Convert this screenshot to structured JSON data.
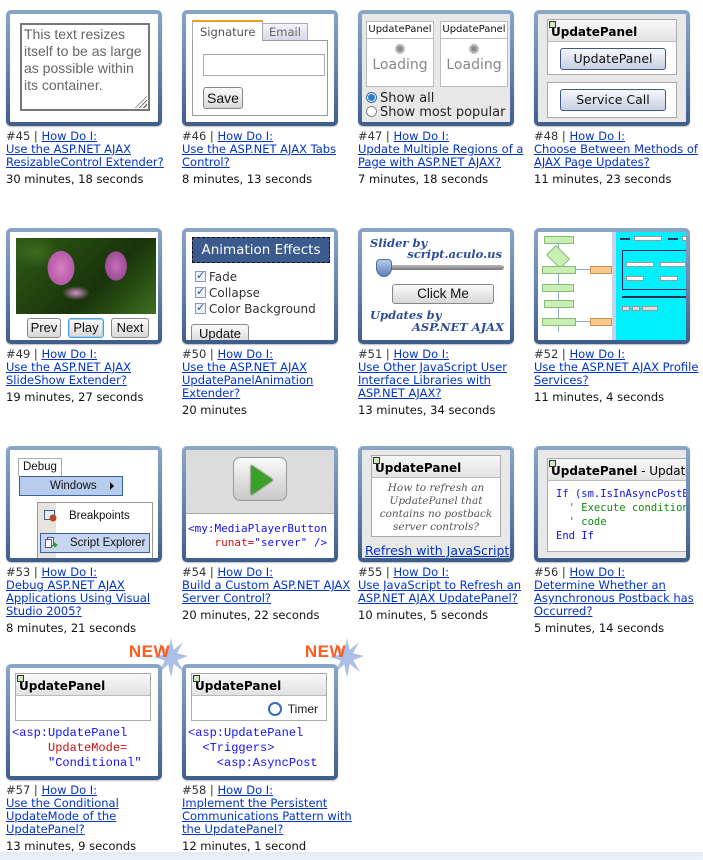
{
  "link_prefix": "How Do I:",
  "new_badge_label": "NEW",
  "colors": {
    "frame": "#4a6a9a",
    "link": "#0033cc",
    "new_badge": "#ff5a1a"
  },
  "videos": [
    {
      "number": "#45 |",
      "title": "Use the ASP.NET AJAX ResizableControl Extender?",
      "duration": "30 minutes, 18 seconds",
      "thumbnail": {
        "text": "This text resizes itself to be as large as possible within its container."
      }
    },
    {
      "number": "#46 |",
      "title": "Use the ASP.NET AJAX Tabs Control?",
      "duration": "8 minutes, 13 seconds",
      "thumbnail": {
        "tabs": [
          "Signature",
          "Email"
        ],
        "active_tab": "Signature",
        "input_value": "",
        "button": "Save"
      }
    },
    {
      "number": "#47 |",
      "title": "Update Multiple Regions of a Page with ASP.NET AJAX?",
      "duration": "7 minutes, 18 seconds",
      "thumbnail": {
        "panels": [
          {
            "header": "UpdatePanel",
            "status": "Loading"
          },
          {
            "header": "UpdatePanel",
            "status": "Loading"
          }
        ],
        "radio_options": [
          {
            "label": "Show all",
            "selected": true
          },
          {
            "label": "Show most popular",
            "selected": false
          }
        ]
      }
    },
    {
      "number": "#48 |",
      "title": "Choose Between Methods of AJAX Page Updates?",
      "duration": "11 minutes, 23 seconds",
      "thumbnail": {
        "header": "UpdatePanel",
        "buttons": [
          "UpdatePanel",
          "Service Call"
        ]
      }
    },
    {
      "number": "#49 |",
      "title": "Use the ASP.NET AJAX SlideShow Extender?",
      "duration": "19 minutes, 27 seconds",
      "thumbnail": {
        "buttons": [
          "Prev",
          "Play",
          "Next"
        ]
      }
    },
    {
      "number": "#50 |",
      "title": "Use the ASP.NET AJAX UpdatePanelAnimation Extender?",
      "duration": "20 minutes",
      "thumbnail": {
        "header": "Animation Effects",
        "checkboxes": [
          {
            "label": "Fade",
            "checked": true
          },
          {
            "label": "Collapse",
            "checked": true
          },
          {
            "label": "Color Background",
            "checked": true
          }
        ],
        "button": "Update"
      }
    },
    {
      "number": "#51 |",
      "title": "Use Other JavaScript User Interface Libraries with ASP.NET AJAX?",
      "duration": "13 minutes, 34 seconds",
      "thumbnail": {
        "line1": "Slider by",
        "line2": "script.aculo.us",
        "button": "Click Me",
        "line3": "Updates by",
        "line4": "ASP.NET AJAX",
        "slider_value": 0
      }
    },
    {
      "number": "#52 |",
      "title": "Use the ASP.NET AJAX Profile Services?",
      "duration": "11 minutes, 4 seconds",
      "thumbnail": {
        "description": "flowchart-and-profile-form-screenshot"
      }
    },
    {
      "number": "#53 |",
      "title": "Debug ASP.NET AJAX Applications Using Visual Studio 2005?",
      "duration": "8 minutes, 21 seconds",
      "thumbnail": {
        "menu": "Debug",
        "submenu": "Windows",
        "items": [
          "Breakpoints",
          "Script Explorer"
        ]
      }
    },
    {
      "number": "#54 |",
      "title": "Build a Custom ASP.NET AJAX Server Control?",
      "duration": "20 minutes, 22 seconds",
      "thumbnail": {
        "code_tag": "<my:MediaPlayerButton",
        "code_attr": "runat=",
        "code_val": "\"server\"",
        "code_end": " />"
      }
    },
    {
      "number": "#55 |",
      "title": "Use JavaScript to Refresh an ASP.NET AJAX UpdatePanel?",
      "duration": "10 minutes, 5 seconds",
      "thumbnail": {
        "header": "UpdatePanel",
        "question": "How to refresh an UpdatePanel that contains no postback server controls?",
        "link": "Refresh with JavaScript"
      }
    },
    {
      "number": "#56 |",
      "title": "Determine Whether an Asynchronous Postback has Occurred?",
      "duration": "5 minutes, 14 seconds",
      "thumbnail": {
        "header": "UpdatePanel",
        "header_suffix": " - UpdatePane",
        "code": [
          "If (sm.IsInAsyncPostBack)",
          "  ' Execute conditional",
          "  ' code",
          "End If"
        ]
      }
    },
    {
      "number": "#57 |",
      "title": "Use the Conditional UpdateMode of the UpdatePanel?",
      "duration": "13 minutes, 9 seconds",
      "is_new": true,
      "thumbnail": {
        "header": "UpdatePanel",
        "code_tag": "<asp:UpdatePanel",
        "code_attr": "UpdateMode=",
        "code_val": "\"Conditional\""
      }
    },
    {
      "number": "#58 |",
      "title": "Implement the Persistent Communications Pattern with the UpdatePanel?",
      "duration": "12 minutes, 1 second",
      "is_new": true,
      "thumbnail": {
        "header": "UpdatePanel",
        "timer_label": "Timer",
        "code": [
          "<asp:UpdatePanel",
          "  <Triggers>",
          "    <asp:AsyncPost"
        ]
      }
    }
  ]
}
